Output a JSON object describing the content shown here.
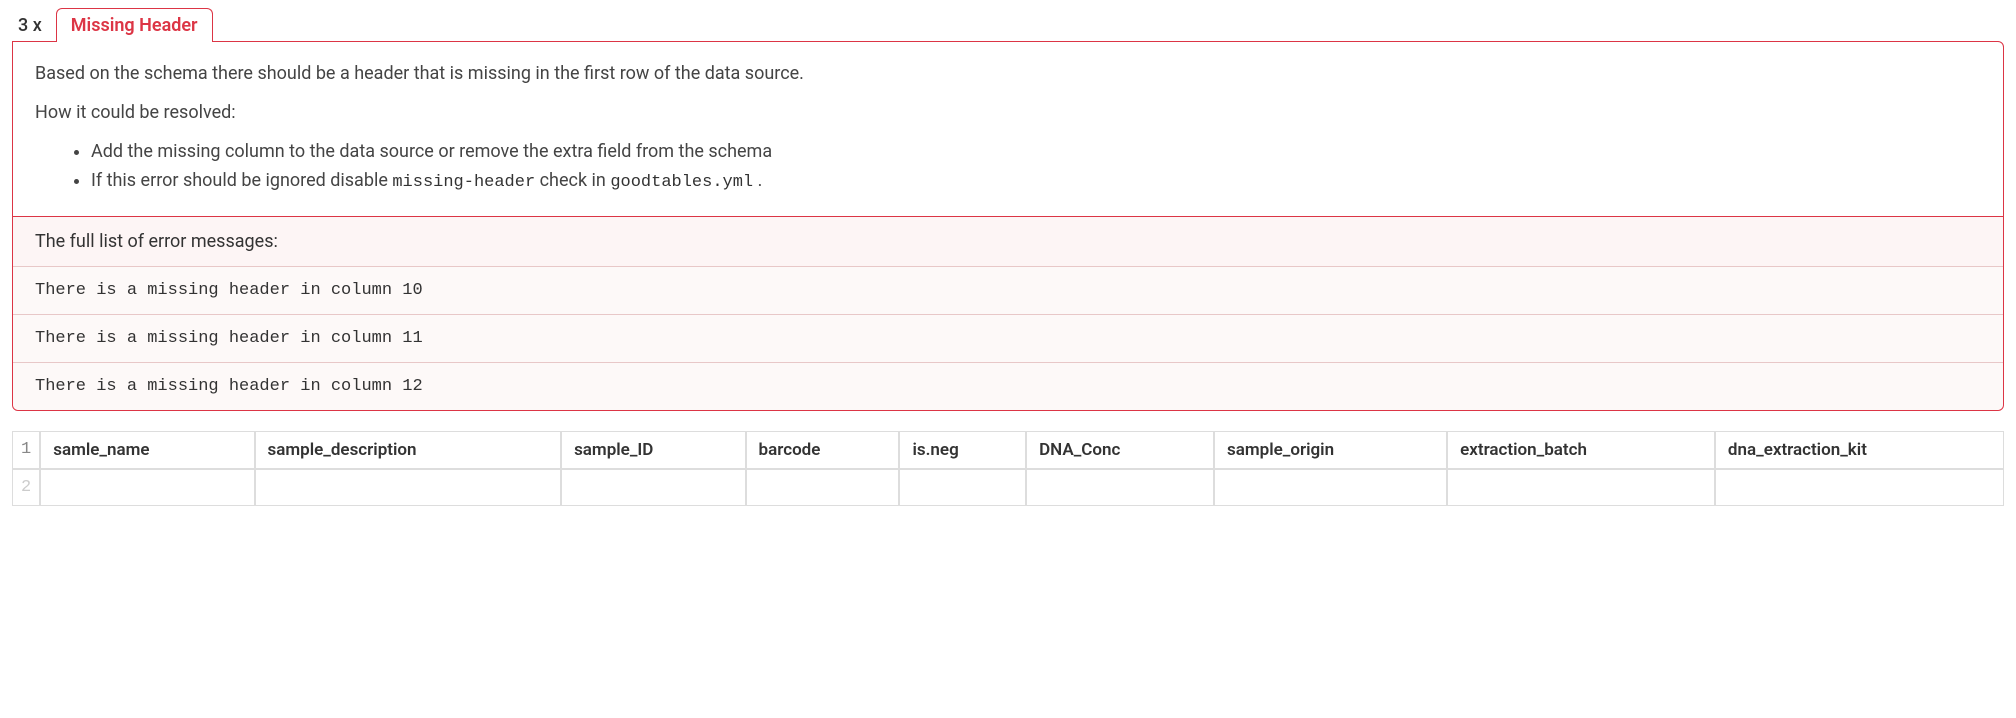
{
  "error": {
    "count": "3 x",
    "title": "Missing Header",
    "description_main": "Based on the schema there should be a header that is missing in the first row of the data source.",
    "resolution_intro": "How it could be resolved:",
    "resolution_items": [
      "Add the missing column to the data source or remove the extra field from the schema",
      {
        "prefix": "If this error should be ignored disable ",
        "code1": "missing-header",
        "mid": " check in ",
        "code2": "goodtables.yml",
        "suffix": " ."
      }
    ],
    "full_list_title": "The full list of error messages:",
    "messages": [
      "There is a missing header in column 10",
      "There is a missing header in column 11",
      "There is a missing header in column 12"
    ]
  },
  "table": {
    "rows": [
      {
        "num": "1",
        "cells": [
          "samle_name",
          "sample_description",
          "sample_ID",
          "barcode",
          "is.neg",
          "DNA_Conc",
          "sample_origin",
          "extraction_batch",
          "dna_extraction_kit"
        ]
      },
      {
        "num": "2",
        "cells": [
          "",
          "",
          "",
          "",
          "",
          "",
          "",
          "",
          ""
        ]
      }
    ]
  }
}
